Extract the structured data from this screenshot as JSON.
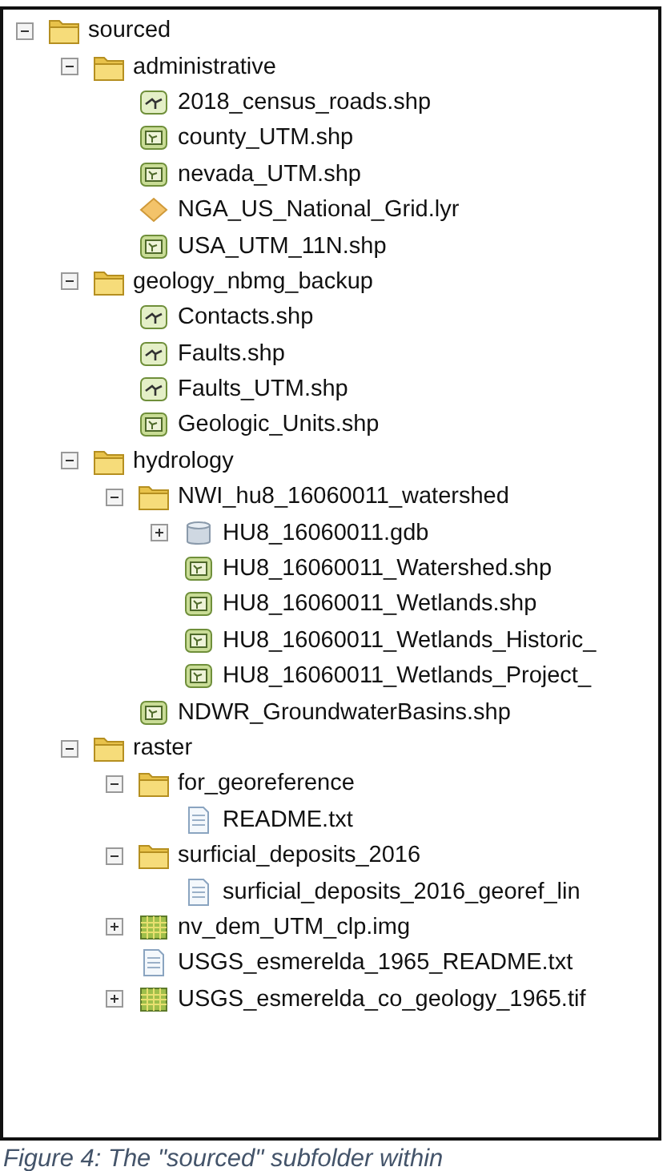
{
  "tree": [
    {
      "kind": "folder",
      "label": "sourced",
      "expanded": true,
      "children": [
        {
          "kind": "folder",
          "label": "administrative",
          "expanded": true,
          "children": [
            {
              "kind": "line",
              "label": "2018_census_roads.shp"
            },
            {
              "kind": "polygon",
              "label": "county_UTM.shp"
            },
            {
              "kind": "polygon",
              "label": "nevada_UTM.shp"
            },
            {
              "kind": "layer",
              "label": "NGA_US_National_Grid.lyr"
            },
            {
              "kind": "polygon",
              "label": "USA_UTM_11N.shp"
            }
          ]
        },
        {
          "kind": "folder",
          "label": "geology_nbmg_backup",
          "expanded": true,
          "children": [
            {
              "kind": "line",
              "label": "Contacts.shp"
            },
            {
              "kind": "line",
              "label": "Faults.shp"
            },
            {
              "kind": "line",
              "label": "Faults_UTM.shp"
            },
            {
              "kind": "polygon",
              "label": "Geologic_Units.shp"
            }
          ]
        },
        {
          "kind": "folder",
          "label": "hydrology",
          "expanded": true,
          "children": [
            {
              "kind": "folder",
              "label": "NWI_hu8_16060011_watershed",
              "expanded": true,
              "children": [
                {
                  "kind": "database",
                  "label": "HU8_16060011.gdb",
                  "expanded": false
                },
                {
                  "kind": "polygon",
                  "label": "HU8_16060011_Watershed.shp"
                },
                {
                  "kind": "polygon",
                  "label": "HU8_16060011_Wetlands.shp"
                },
                {
                  "kind": "polygon",
                  "label": "HU8_16060011_Wetlands_Historic_"
                },
                {
                  "kind": "polygon",
                  "label": "HU8_16060011_Wetlands_Project_"
                }
              ]
            },
            {
              "kind": "polygon",
              "label": "NDWR_GroundwaterBasins.shp"
            }
          ]
        },
        {
          "kind": "folder",
          "label": "raster",
          "expanded": true,
          "children": [
            {
              "kind": "folder",
              "label": "for_georeference",
              "expanded": true,
              "children": [
                {
                  "kind": "text",
                  "label": "README.txt"
                }
              ]
            },
            {
              "kind": "folder",
              "label": "surficial_deposits_2016",
              "expanded": true,
              "children": [
                {
                  "kind": "text",
                  "label": "surficial_deposits_2016_georef_lin"
                }
              ]
            },
            {
              "kind": "raster",
              "label": "nv_dem_UTM_clp.img",
              "expanded": false
            },
            {
              "kind": "text",
              "label": "USGS_esmerelda_1965_README.txt"
            },
            {
              "kind": "raster",
              "label": "USGS_esmerelda_co_geology_1965.tif",
              "expanded": false
            }
          ]
        }
      ]
    }
  ],
  "caption": "Figure 4: The \"sourced\" subfolder within"
}
